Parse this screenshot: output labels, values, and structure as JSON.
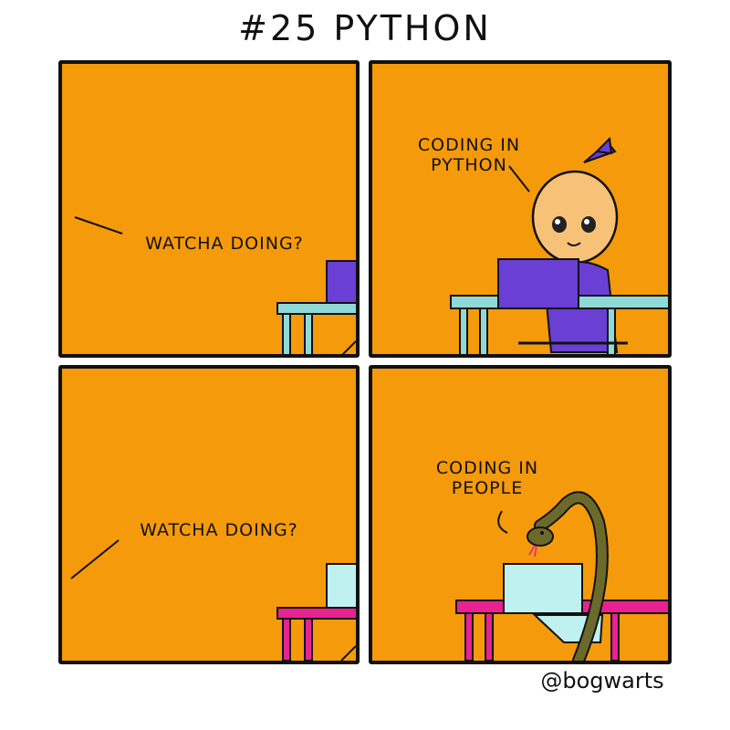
{
  "title": "#25 PYTHON",
  "panels": [
    {
      "speech": "WATCHA DOING?"
    },
    {
      "speech_line1": "CODING IN",
      "speech_line2": "PYTHON"
    },
    {
      "speech": "WATCHA DOING?"
    },
    {
      "speech_line1": "CODING IN",
      "speech_line2": "PEOPLE"
    }
  ],
  "credit": "@bogwarts",
  "colors": {
    "panel_bg": "#f59a0a",
    "laptop_purple": "#6a3fd4",
    "desk_teal": "#8fd9d6",
    "laptop_light": "#bff1f1",
    "desk_pink": "#e8228f",
    "snake_green": "#6b6a2a"
  }
}
